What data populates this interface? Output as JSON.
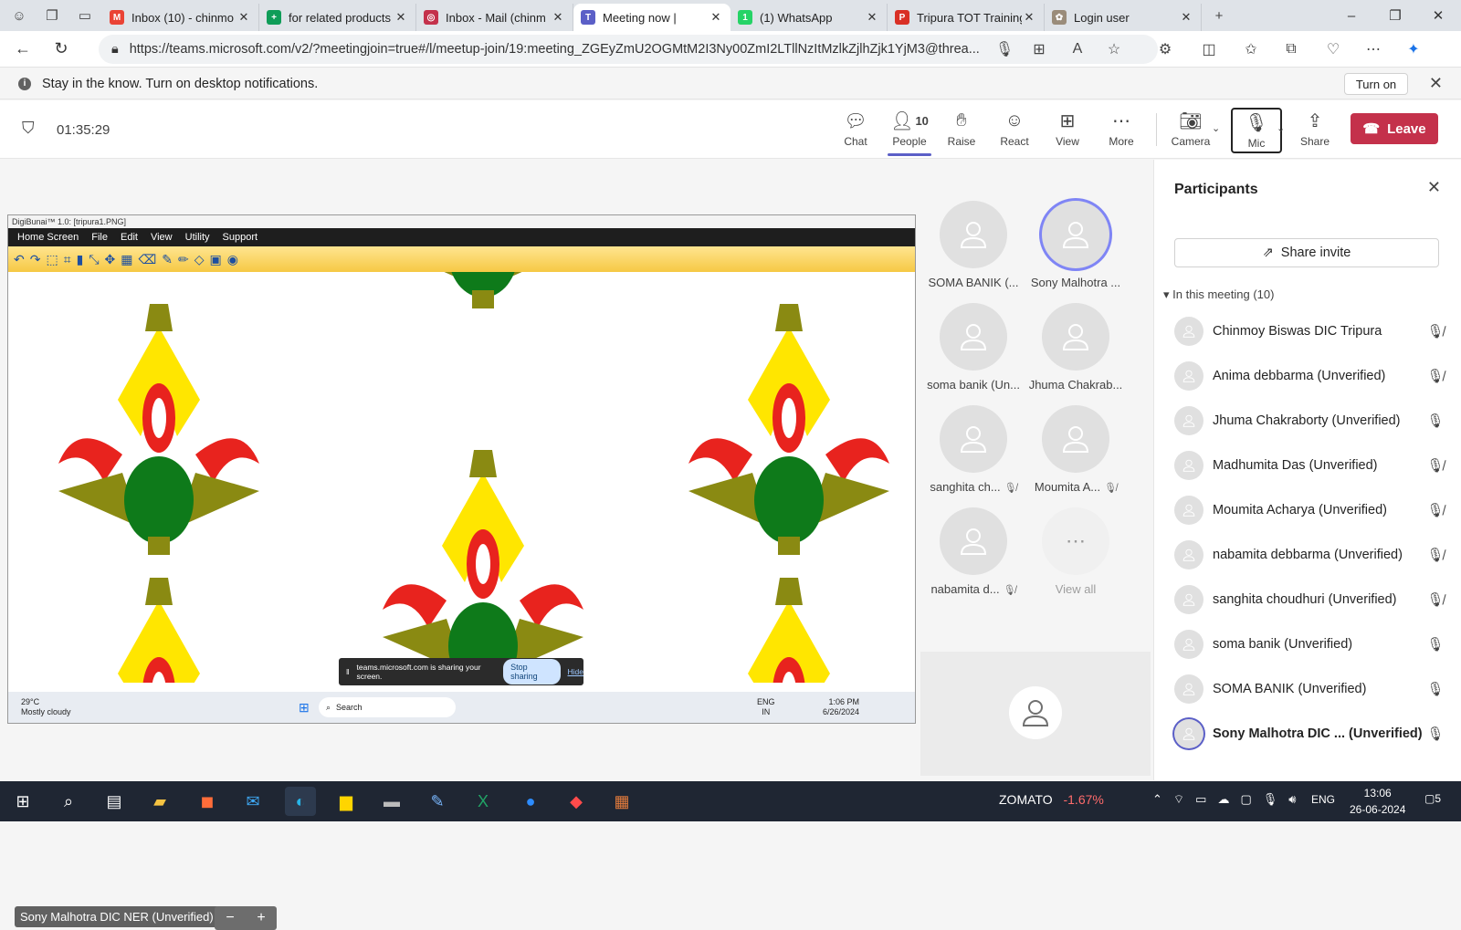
{
  "browser": {
    "tabs": [
      {
        "title": "Inbox (10) - chinmo",
        "favicon": "gmail-icon",
        "color": "#ea4335",
        "letter": "M"
      },
      {
        "title": "for related products",
        "favicon": "sheets-icon",
        "color": "#0f9d58",
        "letter": "+"
      },
      {
        "title": "Inbox - Mail (chinm",
        "favicon": "mail-icon",
        "color": "#c4314b",
        "letter": "◎"
      },
      {
        "title": "Meeting now |",
        "favicon": "teams-icon",
        "color": "#5b5fc7",
        "letter": "T",
        "active": true
      },
      {
        "title": "(1) WhatsApp",
        "favicon": "whatsapp-icon",
        "color": "#25d366",
        "letter": "1"
      },
      {
        "title": "Tripura TOT Training",
        "favicon": "pdf-icon",
        "color": "#d93025",
        "letter": "P"
      },
      {
        "title": "Login user",
        "favicon": "site-icon",
        "color": "#9a8c7a",
        "letter": "✿"
      }
    ],
    "url": "https://teams.microsoft.com/v2/?meetingjoin=true#/l/meetup-join/19:meeting_ZGEyZmU2OGMtM2I3Ny00ZmI2LTllNzItMzlkZjlhZjk1YjM3@threa..."
  },
  "notification": {
    "message": "Stay in the know. Turn on desktop notifications.",
    "action": "Turn on"
  },
  "meeting": {
    "timer": "01:35:29",
    "controls": {
      "chat": "Chat",
      "people": "People",
      "people_count": "10",
      "raise": "Raise",
      "react": "React",
      "view": "View",
      "more": "More",
      "camera": "Camera",
      "mic": "Mic",
      "share": "Share",
      "leave": "Leave"
    }
  },
  "shared_screen": {
    "title": "DigiBunai™ 1.0: [tripura1.PNG]",
    "menu": [
      "Home Screen",
      "File",
      "Edit",
      "View",
      "Utility",
      "Support"
    ],
    "banner_text": "teams.microsoft.com is sharing your screen.",
    "banner_stop": "Stop sharing",
    "banner_hide": "Hide",
    "weather_temp": "29°C",
    "weather_desc": "Mostly cloudy",
    "search": "Search",
    "lang": "ENG",
    "region": "IN",
    "time": "1:06 PM",
    "date": "6/26/2024"
  },
  "grid": {
    "tiles": [
      {
        "name": "SOMA BANIK (...",
        "muted": false,
        "speaking": false
      },
      {
        "name": "Sony Malhotra ...",
        "muted": false,
        "speaking": true
      },
      {
        "name": "soma banik (Un...",
        "muted": false,
        "speaking": false
      },
      {
        "name": "Jhuma Chakrab...",
        "muted": false,
        "speaking": false
      },
      {
        "name": "sanghita ch...",
        "muted": true,
        "speaking": false
      },
      {
        "name": "Moumita A...",
        "muted": true,
        "speaking": false
      },
      {
        "name": "nabamita d...",
        "muted": true,
        "speaking": false
      }
    ],
    "view_all": "View all"
  },
  "stage": {
    "pinned_name": "Sony Malhotra DIC NER (Unverified)"
  },
  "participants": {
    "title": "Participants",
    "share_invite": "Share invite",
    "section": "In this meeting (10)",
    "list": [
      {
        "name": "Chinmoy Biswas DIC Tripura",
        "muted": true
      },
      {
        "name": "Anima debbarma (Unverified)",
        "muted": true
      },
      {
        "name": "Jhuma Chakraborty (Unverified)",
        "muted": false
      },
      {
        "name": "Madhumita Das (Unverified)",
        "muted": true
      },
      {
        "name": "Moumita Acharya (Unverified)",
        "muted": true
      },
      {
        "name": "nabamita debbarma (Unverified)",
        "muted": true
      },
      {
        "name": "sanghita choudhuri (Unverified)",
        "muted": true
      },
      {
        "name": "soma banik (Unverified)",
        "muted": false
      },
      {
        "name": "SOMA BANIK (Unverified)",
        "muted": false
      },
      {
        "name": "Sony Malhotra DIC ... (Unverified)",
        "muted": false,
        "bold": true
      }
    ]
  },
  "taskbar": {
    "stock_name": "ZOMATO",
    "stock_change": "-1.67%",
    "lang": "ENG",
    "time": "13:06",
    "date": "26-06-2024",
    "notification_count": "5"
  }
}
